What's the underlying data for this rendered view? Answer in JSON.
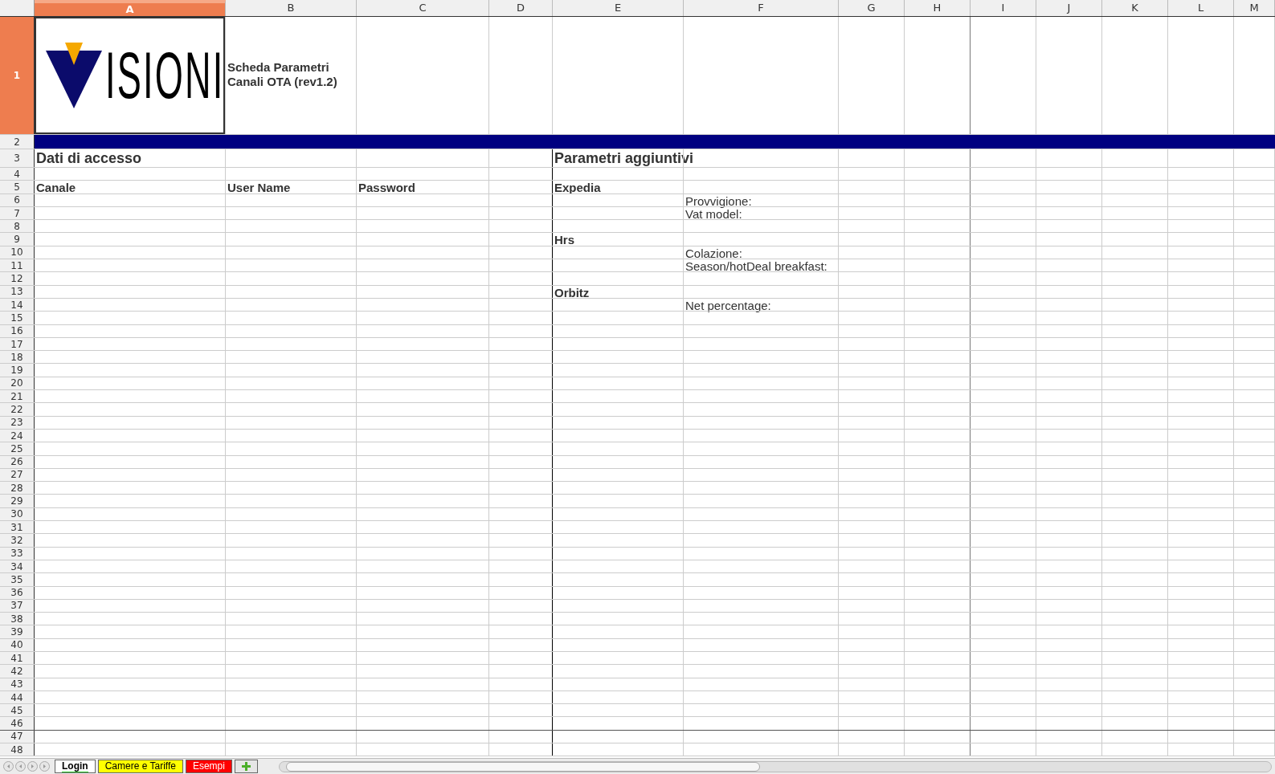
{
  "columns": [
    {
      "label": "A",
      "selected": true
    },
    {
      "label": "B",
      "selected": false
    },
    {
      "label": "C",
      "selected": false
    },
    {
      "label": "D",
      "selected": false
    },
    {
      "label": "E",
      "selected": false
    },
    {
      "label": "F",
      "selected": false
    },
    {
      "label": "G",
      "selected": false
    },
    {
      "label": "H",
      "selected": false
    },
    {
      "label": "I",
      "selected": false
    },
    {
      "label": "J",
      "selected": false
    },
    {
      "label": "K",
      "selected": false
    },
    {
      "label": "L",
      "selected": false
    },
    {
      "label": "M",
      "selected": false
    }
  ],
  "rows": [
    {
      "number": "1",
      "selected": true,
      "kind": "tall",
      "col_a": {
        "kind": "logo",
        "text": "ISIONI"
      },
      "col_b": {
        "kind": "title",
        "text": "Scheda Parametri Canali OTA (rev1.2)"
      }
    },
    {
      "number": "2",
      "selected": false,
      "kind": "band"
    },
    {
      "number": "3",
      "selected": false,
      "kind": "heading",
      "col_a": {
        "kind": "heading",
        "text": "Dati di accesso"
      },
      "col_e": {
        "kind": "heading",
        "text": "Parametri aggiuntivi"
      }
    },
    {
      "number": "4",
      "selected": false,
      "kind": "plain"
    },
    {
      "number": "5",
      "selected": false,
      "kind": "plain",
      "col_a": {
        "kind": "header",
        "text": "Canale"
      },
      "col_b": {
        "kind": "header",
        "text": "User Name"
      },
      "col_c": {
        "kind": "header",
        "text": "Password"
      },
      "col_e": {
        "kind": "header",
        "text": "Expedia"
      }
    },
    {
      "number": "6",
      "selected": false,
      "kind": "plain",
      "col_f": {
        "kind": "label",
        "text": "Provvigione:"
      }
    },
    {
      "number": "7",
      "selected": false,
      "kind": "plain",
      "col_f": {
        "kind": "label",
        "text": "Vat model:"
      }
    },
    {
      "number": "8",
      "selected": false,
      "kind": "plain"
    },
    {
      "number": "9",
      "selected": false,
      "kind": "plain",
      "col_e": {
        "kind": "header",
        "text": "Hrs"
      }
    },
    {
      "number": "10",
      "selected": false,
      "kind": "plain",
      "col_f": {
        "kind": "label",
        "text": "Colazione:"
      }
    },
    {
      "number": "11",
      "selected": false,
      "kind": "plain",
      "col_f": {
        "kind": "label",
        "text": "Season/hotDeal breakfast:"
      }
    },
    {
      "number": "12",
      "selected": false,
      "kind": "plain"
    },
    {
      "number": "13",
      "selected": false,
      "kind": "plain",
      "col_e": {
        "kind": "header",
        "text": "Orbitz"
      }
    },
    {
      "number": "14",
      "selected": false,
      "kind": "plain",
      "col_f": {
        "kind": "label",
        "text": "Net percentage:"
      }
    },
    {
      "number": "15",
      "selected": false,
      "kind": "plain"
    },
    {
      "number": "16",
      "selected": false,
      "kind": "plain"
    },
    {
      "number": "17",
      "selected": false,
      "kind": "plain"
    },
    {
      "number": "18",
      "selected": false,
      "kind": "plain"
    },
    {
      "number": "19",
      "selected": false,
      "kind": "plain"
    },
    {
      "number": "20",
      "selected": false,
      "kind": "plain"
    },
    {
      "number": "21",
      "selected": false,
      "kind": "plain"
    },
    {
      "number": "22",
      "selected": false,
      "kind": "plain"
    },
    {
      "number": "23",
      "selected": false,
      "kind": "plain"
    },
    {
      "number": "24",
      "selected": false,
      "kind": "plain"
    },
    {
      "number": "25",
      "selected": false,
      "kind": "plain"
    },
    {
      "number": "26",
      "selected": false,
      "kind": "plain"
    },
    {
      "number": "27",
      "selected": false,
      "kind": "plain"
    },
    {
      "number": "28",
      "selected": false,
      "kind": "plain"
    },
    {
      "number": "29",
      "selected": false,
      "kind": "plain"
    },
    {
      "number": "30",
      "selected": false,
      "kind": "plain"
    },
    {
      "number": "31",
      "selected": false,
      "kind": "plain"
    },
    {
      "number": "32",
      "selected": false,
      "kind": "plain"
    },
    {
      "number": "33",
      "selected": false,
      "kind": "plain"
    },
    {
      "number": "34",
      "selected": false,
      "kind": "plain"
    },
    {
      "number": "35",
      "selected": false,
      "kind": "plain"
    },
    {
      "number": "36",
      "selected": false,
      "kind": "plain"
    },
    {
      "number": "37",
      "selected": false,
      "kind": "plain"
    },
    {
      "number": "38",
      "selected": false,
      "kind": "plain"
    },
    {
      "number": "39",
      "selected": false,
      "kind": "plain"
    },
    {
      "number": "40",
      "selected": false,
      "kind": "plain"
    },
    {
      "number": "41",
      "selected": false,
      "kind": "plain"
    },
    {
      "number": "42",
      "selected": false,
      "kind": "plain"
    },
    {
      "number": "43",
      "selected": false,
      "kind": "plain"
    },
    {
      "number": "44",
      "selected": false,
      "kind": "plain"
    },
    {
      "number": "45",
      "selected": false,
      "kind": "plain"
    },
    {
      "number": "46",
      "selected": false,
      "kind": "plain"
    },
    {
      "number": "47",
      "selected": false,
      "kind": "plain"
    },
    {
      "number": "48",
      "selected": false,
      "kind": "plain"
    }
  ],
  "sheet_tabs": [
    {
      "label": "Login",
      "selected": true,
      "color": "#33cc33"
    },
    {
      "label": "Camere e Tariffe",
      "selected": false,
      "color": "#ffff00"
    },
    {
      "label": "Esempi",
      "selected": false,
      "color": "#ff0000"
    }
  ]
}
